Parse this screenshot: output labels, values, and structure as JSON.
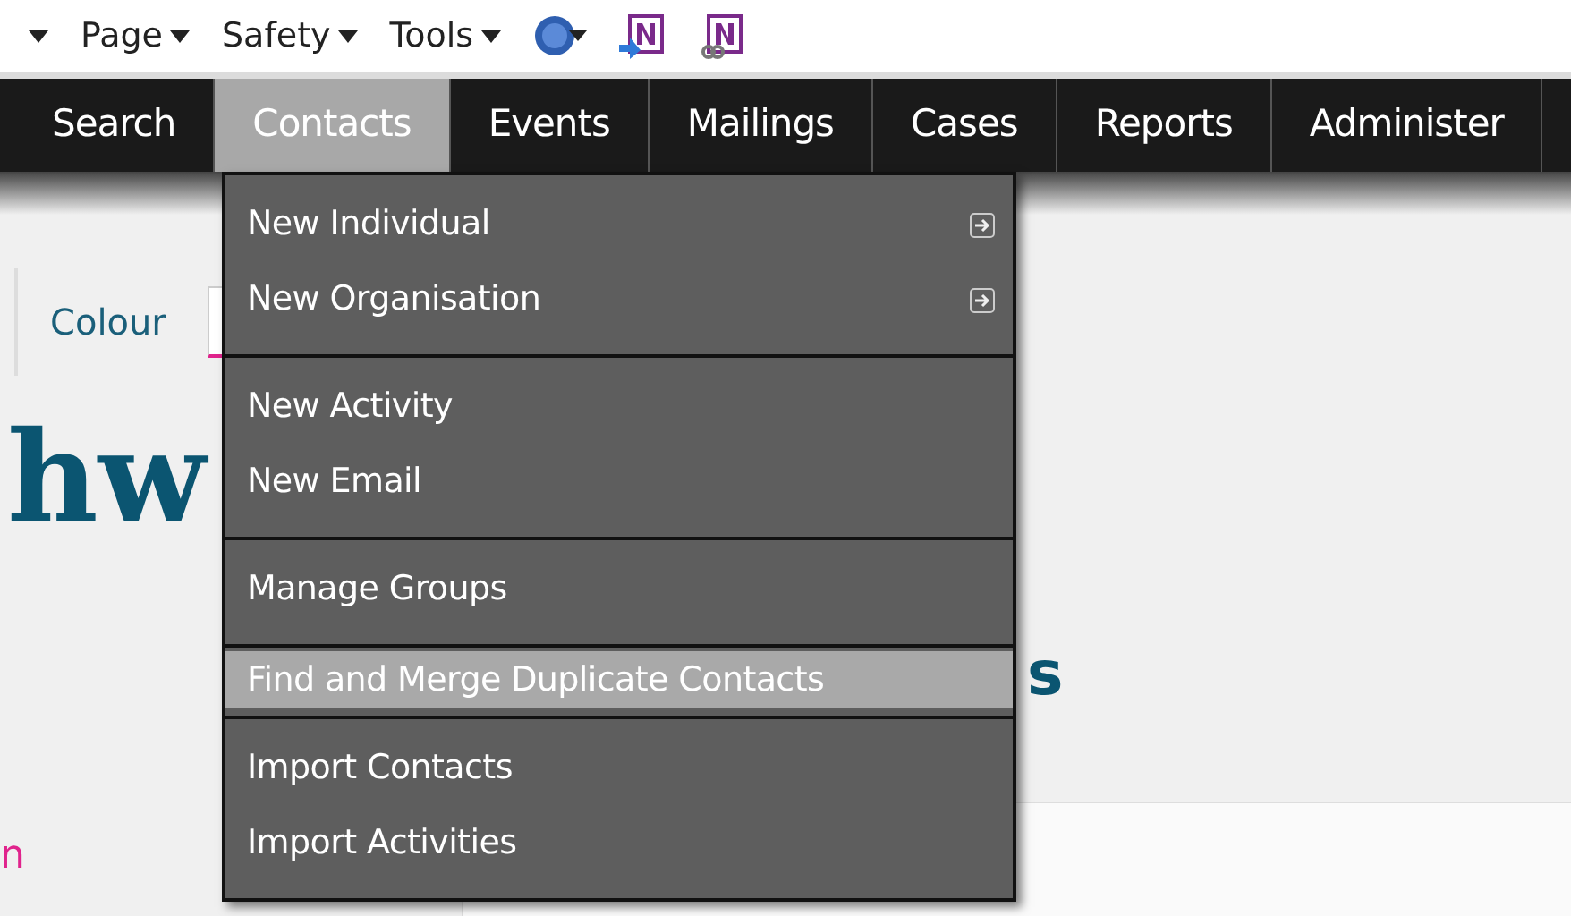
{
  "browser_toolbar": [
    {
      "label": "Page"
    },
    {
      "label": "Safety"
    },
    {
      "label": "Tools"
    }
  ],
  "nav_tabs": [
    {
      "label": "Search",
      "selected": false
    },
    {
      "label": "Contacts",
      "selected": true
    },
    {
      "label": "Events",
      "selected": false
    },
    {
      "label": "Mailings",
      "selected": false
    },
    {
      "label": "Cases",
      "selected": false
    },
    {
      "label": "Reports",
      "selected": false
    },
    {
      "label": "Administer",
      "selected": false
    }
  ],
  "dropdown_menu": {
    "groups": [
      {
        "items": [
          {
            "label": "New Individual",
            "has_submenu": true,
            "selected": false
          },
          {
            "label": "New Organisation",
            "has_submenu": true,
            "selected": false
          }
        ]
      },
      {
        "items": [
          {
            "label": "New Activity",
            "has_submenu": false,
            "selected": false
          },
          {
            "label": "New Email",
            "has_submenu": false,
            "selected": false
          }
        ]
      },
      {
        "items": [
          {
            "label": "Manage Groups",
            "has_submenu": false,
            "selected": false
          }
        ]
      },
      {
        "items": [
          {
            "label": "Find and Merge Duplicate Contacts",
            "has_submenu": false,
            "selected": true
          }
        ]
      },
      {
        "items": [
          {
            "label": "Import Contacts",
            "has_submenu": false,
            "selected": false
          },
          {
            "label": "Import Activities",
            "has_submenu": false,
            "selected": false
          }
        ]
      }
    ]
  },
  "page": {
    "colour_label": "Colour",
    "heading_fragment": "hw",
    "subheading_fragment": "s",
    "link_fragment": "n"
  }
}
